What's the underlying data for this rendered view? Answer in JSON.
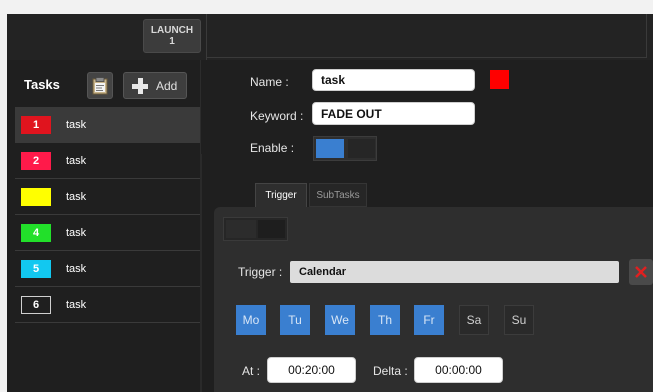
{
  "topbar": {
    "launch_label": "LAUNCH",
    "launch_number": "1"
  },
  "sidebar": {
    "title": "Tasks",
    "add_label": "Add",
    "tasks": [
      {
        "num": "1",
        "name": "task",
        "color": "#e0141e",
        "selected": true
      },
      {
        "num": "2",
        "name": "task",
        "color": "#ff1a4a"
      },
      {
        "num": "3",
        "name": "task",
        "color": "#ffff00"
      },
      {
        "num": "4",
        "name": "task",
        "color": "#22e02a"
      },
      {
        "num": "5",
        "name": "task",
        "color": "#12c8f0"
      },
      {
        "num": "6",
        "name": "task",
        "color": "#1f1f1f"
      }
    ]
  },
  "form": {
    "name_label": "Name :",
    "name_value": "task",
    "keyword_label": "Keyword :",
    "keyword_value": "FADE OUT",
    "enable_label": "Enable :",
    "task_color": "#ff0000"
  },
  "tabs": [
    {
      "label": "Trigger",
      "active": true
    },
    {
      "label": "SubTasks",
      "active": false
    }
  ],
  "trigger": {
    "label": "Trigger :",
    "value": "Calendar",
    "days": [
      {
        "label": "Mo",
        "on": true
      },
      {
        "label": "Tu",
        "on": true
      },
      {
        "label": "We",
        "on": true
      },
      {
        "label": "Th",
        "on": true
      },
      {
        "label": "Fr",
        "on": true
      },
      {
        "label": "Sa",
        "on": false
      },
      {
        "label": "Su",
        "on": false
      }
    ],
    "at_label": "At :",
    "at_value": "00:20:00",
    "delta_label": "Delta :",
    "delta_value": "00:00:00"
  }
}
